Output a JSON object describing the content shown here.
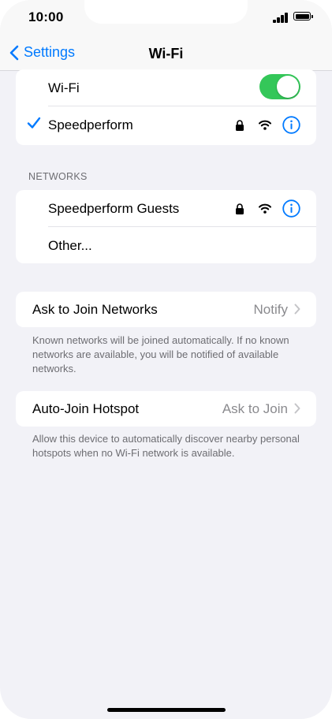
{
  "status_bar": {
    "time": "10:00"
  },
  "nav": {
    "back_label": "Settings",
    "title": "Wi-Fi"
  },
  "wifi_card": {
    "toggle_label": "Wi-Fi",
    "toggle_on": true,
    "connected_network": "Speedperform"
  },
  "networks": {
    "header": "NETWORKS",
    "items": [
      {
        "name": "Speedperform Guests",
        "secured": true
      },
      {
        "name": "Other..."
      }
    ]
  },
  "ask_to_join": {
    "label": "Ask to Join Networks",
    "value": "Notify",
    "footnote": "Known networks will be joined automatically. If no known networks are available, you will be notified of available networks."
  },
  "auto_join": {
    "label": "Auto-Join Hotspot",
    "value": "Ask to Join",
    "footnote": "Allow this device to automatically discover nearby personal hotspots when no Wi-Fi network is available."
  },
  "colors": {
    "accent": "#007aff",
    "toggle_on": "#34c759",
    "background": "#f2f2f7"
  },
  "icons": [
    "chevron-left-icon",
    "checkmark-icon",
    "lock-icon",
    "wifi-icon",
    "info-icon",
    "chevron-right-icon",
    "signal-icon",
    "battery-icon"
  ]
}
